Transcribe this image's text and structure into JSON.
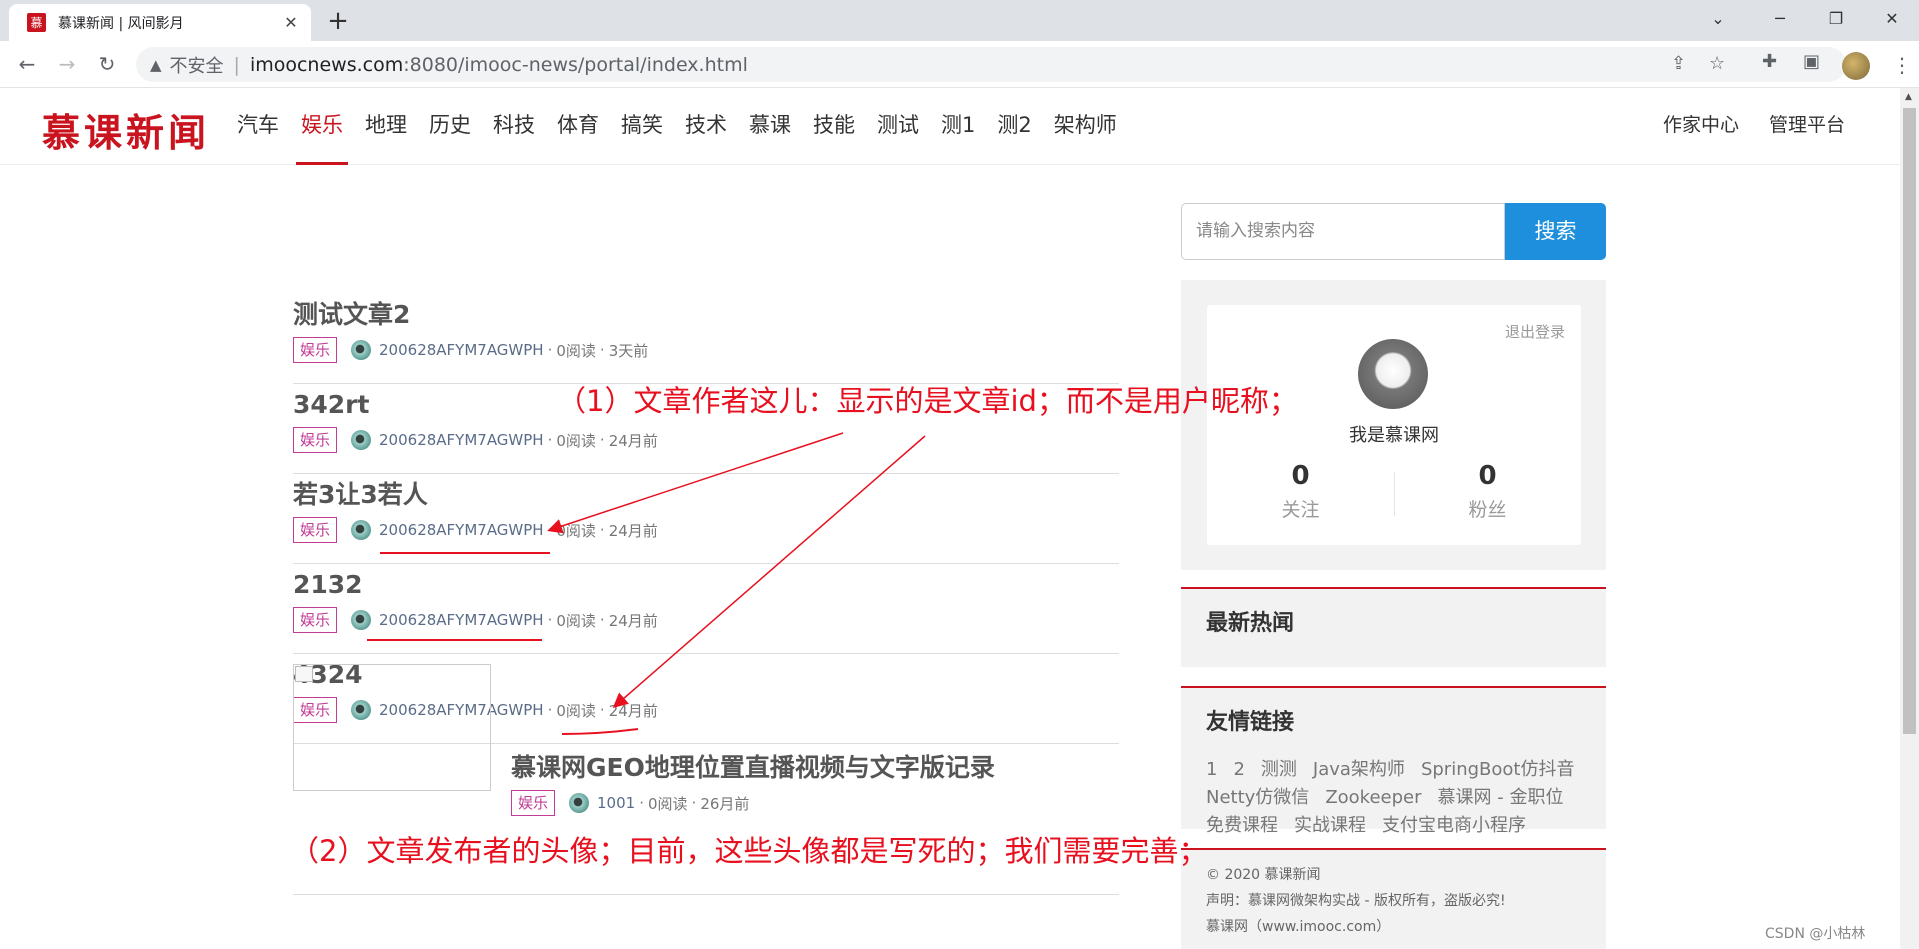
{
  "browser": {
    "tab_title": "慕课新闻 | 风间影月",
    "tab_favicon": "慕",
    "new_tab": "+",
    "close_tab": "✕",
    "insecure_label": "不安全",
    "url_host": "imoocnews.com",
    "url_path": ":8080/imooc-news/portal/index.html"
  },
  "header": {
    "logo": "慕课新闻",
    "nav": [
      "汽车",
      "娱乐",
      "地理",
      "历史",
      "科技",
      "体育",
      "搞笑",
      "技术",
      "慕课",
      "技能",
      "测试",
      "测1",
      "测2",
      "架构师"
    ],
    "nav_active": "娱乐",
    "right_links": [
      "作家中心",
      "管理平台"
    ]
  },
  "articles": [
    {
      "title": "测试文章2",
      "tag": "娱乐",
      "author": "200628AFYM7AGWPH",
      "reads": "0阅读",
      "time": "3天前"
    },
    {
      "title": "342rt",
      "tag": "娱乐",
      "author": "200628AFYM7AGWPH",
      "reads": "0阅读",
      "time": "24月前"
    },
    {
      "title": "若3让3若人",
      "tag": "娱乐",
      "author": "200628AFYM7AGWPH",
      "reads": "0阅读",
      "time": "24月前"
    },
    {
      "title": "2132",
      "tag": "娱乐",
      "author": "200628AFYM7AGWPH",
      "reads": "0阅读",
      "time": "24月前"
    },
    {
      "title": "4324",
      "tag": "娱乐",
      "author": "200628AFYM7AGWPH",
      "reads": "0阅读",
      "time": "24月前"
    },
    {
      "title": "慕课网GEO地理位置直播视频与文字版记录",
      "tag": "娱乐",
      "author": "1001",
      "reads": "0阅读",
      "time": "26月前"
    }
  ],
  "meta_sep": "·",
  "sidebar": {
    "search_placeholder": "请输入搜索内容",
    "search_button": "搜索",
    "logout": "退出登录",
    "user_name": "我是慕课网",
    "follow_count": "0",
    "follow_label": "关注",
    "fans_count": "0",
    "fans_label": "粉丝",
    "hot_title": "最新热闻",
    "links_title": "友情链接",
    "links": [
      "1",
      "2",
      "测测",
      "Java架构师",
      "SpringBoot仿抖音",
      "Netty仿微信",
      "Zookeeper",
      "慕课网 - 金职位",
      "免费课程",
      "实战课程",
      "支付宝电商小程序"
    ],
    "footer_copyright": "© 2020 慕课新闻",
    "footer_statement": "声明：慕课网微架构实战 - 版权所有，盗版必究!",
    "footer_more": "慕课网（www.imooc.com）"
  },
  "annotations": {
    "note1": "（1）文章作者这儿：显示的是文章id；而不是用户昵称；",
    "note2": "（2）文章发布者的头像；目前，这些头像都是写死的；我们需要完善；",
    "color": "#e8101f"
  },
  "watermark": "CSDN @小枯林"
}
